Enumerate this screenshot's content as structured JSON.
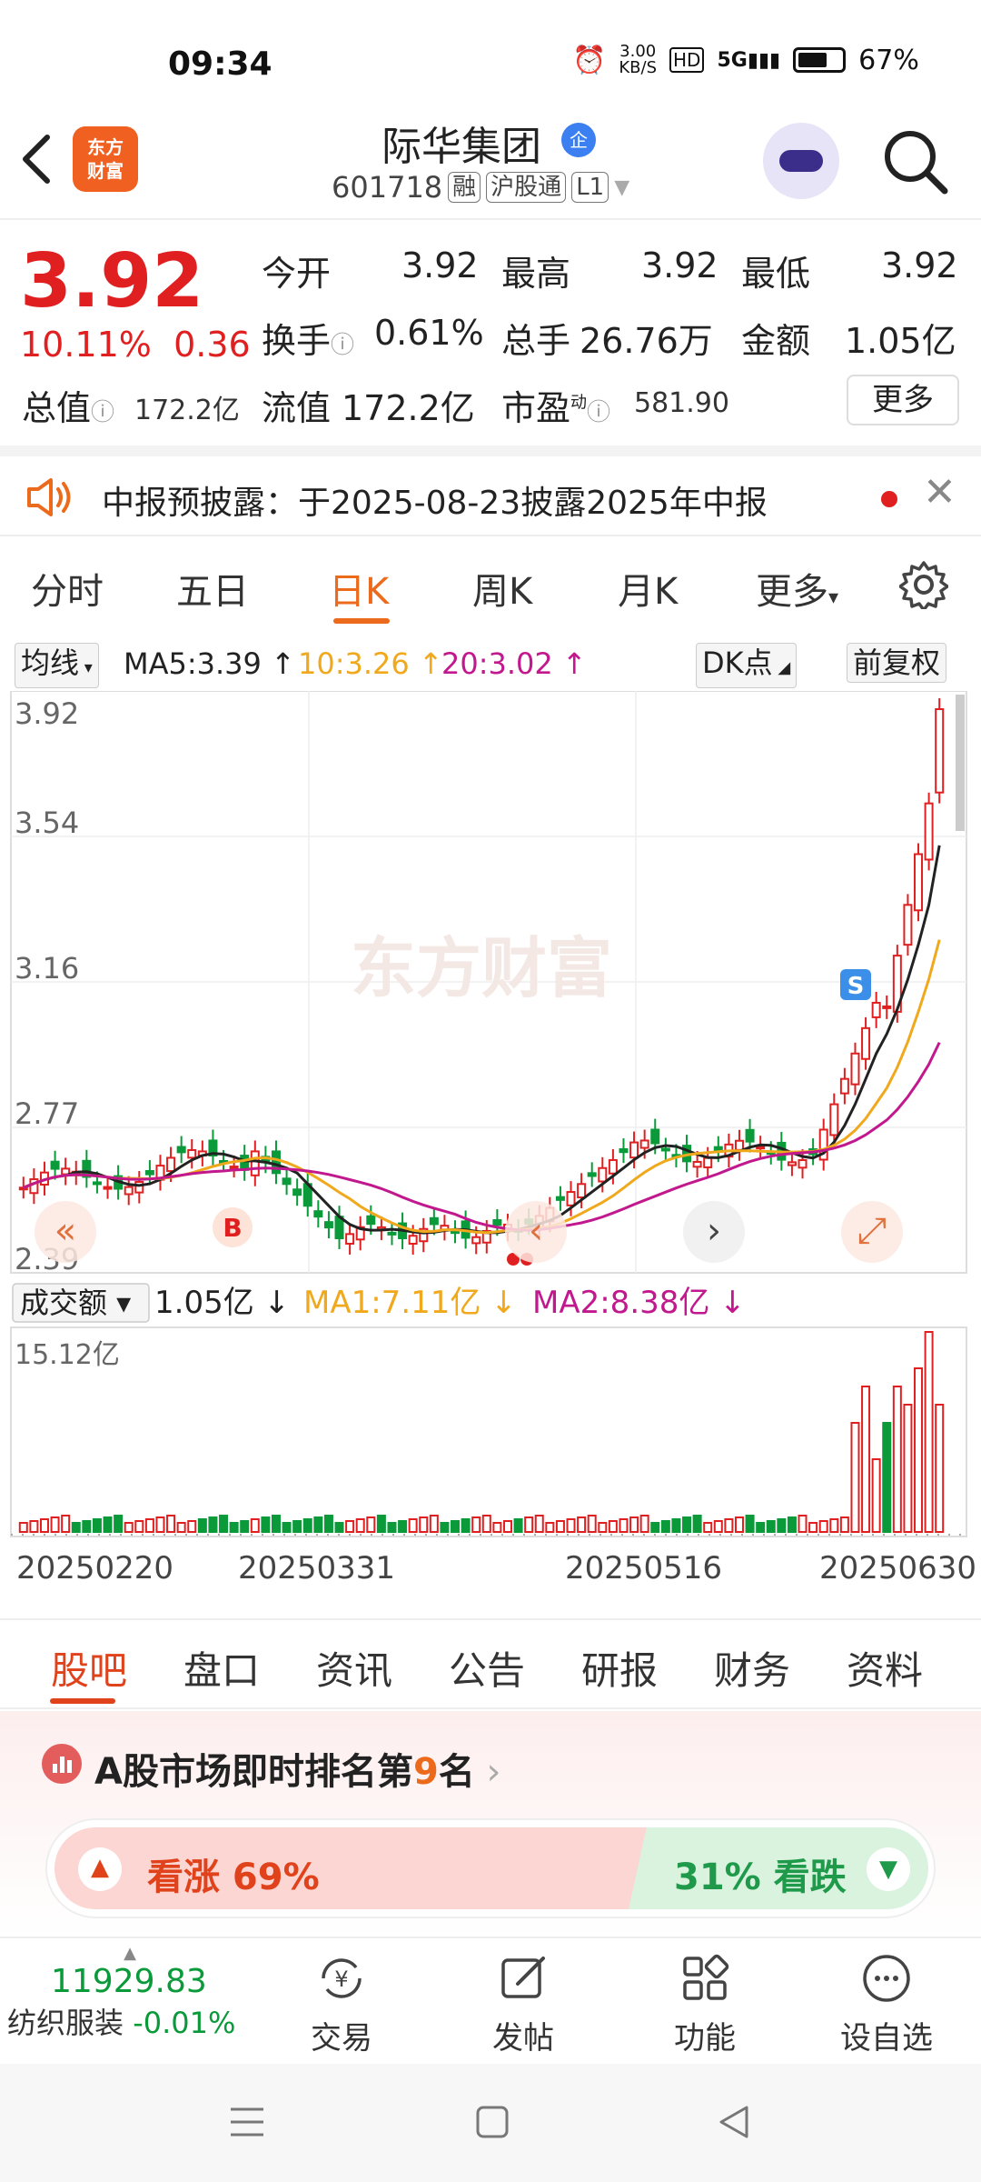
{
  "status": {
    "time": "09:34",
    "speed": "3.00",
    "speed_unit": "KB/S",
    "hd": "HD",
    "net": "5G",
    "battery": "67%"
  },
  "header": {
    "logo_line1": "东方",
    "logo_line2": "财富",
    "name": "际华集团",
    "ent_badge": "企",
    "code": "601718",
    "tags": [
      "融",
      "沪股通",
      "L1"
    ]
  },
  "quote": {
    "price": "3.92",
    "pct": "10.11%",
    "change": "0.36",
    "open_label": "今开",
    "open": "3.92",
    "high_label": "最高",
    "high": "3.92",
    "low_label": "最低",
    "low": "3.92",
    "turnover_label": "换手",
    "turnover": "0.61%",
    "volume_label": "总手",
    "volume": "26.76万",
    "amount_label": "金额",
    "amount": "1.05亿",
    "mktcap_label": "总值",
    "mktcap": "172.2亿",
    "float_label": "流值",
    "float": "172.2亿",
    "pe_label": "市盈",
    "pe_sup": "动",
    "pe": "581.90",
    "more": "更多"
  },
  "notice": {
    "text": "中报预披露：于2025-08-23披露2025年中报"
  },
  "period_tabs": [
    "分时",
    "五日",
    "日K",
    "周K",
    "月K",
    "更多"
  ],
  "ma_legend": {
    "selector": "均线",
    "ma5": "MA5:3.39",
    "ma10": "10:3.26",
    "ma20": "20:3.02",
    "dk": "DK点",
    "adjust": "前复权"
  },
  "chart_data": {
    "type": "candlestick",
    "price_ticks": [
      "3.92",
      "3.54",
      "3.16",
      "2.77",
      "2.39"
    ],
    "watermark": "东方财富",
    "markers": {
      "buy": "B",
      "sell": "S"
    },
    "volume_legend": {
      "selector": "成交额",
      "value": "1.05亿",
      "ma1": "MA1:7.11亿",
      "ma2": "MA2:8.38亿"
    },
    "volume_max": "15.12亿",
    "dates": [
      "20250220",
      "20250331",
      "20250516",
      "20250630"
    ]
  },
  "info_tabs": [
    "股吧",
    "盘口",
    "资讯",
    "公告",
    "研报",
    "财务",
    "资料"
  ],
  "sentiment": {
    "rank_prefix": "A股市场即时排名第",
    "rank_num": "9",
    "rank_suffix": "名",
    "up_label": "看涨 69%",
    "down_label": "31% 看跌"
  },
  "toolbar": {
    "index_value": "11929.83",
    "index_name": "纺织服装",
    "index_change": "-0.01%",
    "trade": "交易",
    "post": "发帖",
    "func": "功能",
    "watch": "设自选"
  },
  "colors": {
    "up": "#e02020",
    "down": "#0a9a3a",
    "accent": "#ec6a1c",
    "ma5": "#222222",
    "ma10": "#f0a81c",
    "ma20": "#c2188e"
  }
}
